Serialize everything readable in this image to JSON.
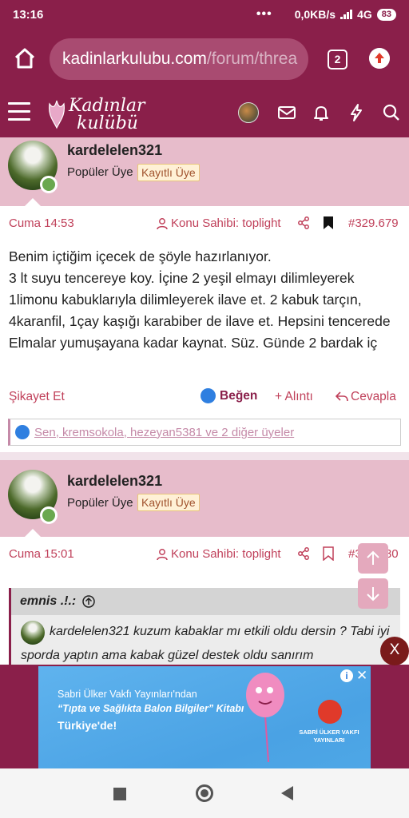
{
  "status_bar": {
    "time": "13:16",
    "dots": "•••",
    "network_speed": "0,0KB/s",
    "network_type": "4G",
    "battery": "83"
  },
  "browser": {
    "url_main": "kadinlarkulubu.com",
    "url_path": "/forum/threa",
    "tab_count": "2"
  },
  "site": {
    "logo_line1": "Kadınlar",
    "logo_line2": "kulübü"
  },
  "posts": [
    {
      "username": "kardelelen321",
      "role": "Popüler Üye",
      "badge": "Kayıtlı Üye",
      "time": "Cuma 14:53",
      "owner_label": "Konu Sahibi: toplight",
      "post_number": "#329.679",
      "body": "Benim içtiğim içecek de şöyle hazırlanıyor.\n3 lt suyu tencereye koy. İçine 2 yeşil elmayı dilimleyerek 1limonu kabuklarıyla dilimleyerek ilave et. 2 kabuk tarçın, 4karanfil, 1çay kaşığı karabiber de ilave et. Hepsini tencerede Elmalar yumuşayana kadar kaynat. Süz. Günde 2 bardak iç",
      "actions": {
        "report": "Şikayet Et",
        "like": "Beğen",
        "quote": "+ Alıntı",
        "reply": "Cevapla"
      },
      "likes_text": "Sen, kremsokola, hezeyan5381 ve 2 diğer üyeler"
    },
    {
      "username": "kardelelen321",
      "role": "Popüler Üye",
      "badge": "Kayıtlı Üye",
      "time": "Cuma 15:01",
      "owner_label": "Konu Sahibi: toplight",
      "post_number": "#329.680",
      "quote": {
        "author": "emnis .!.:",
        "text": "kardelelen321 kuzum kabaklar mı etkili oldu dersin ? Tabi iyi sporda yaptın ama kabak güzel destek oldu sanırım"
      }
    }
  ],
  "ad": {
    "line1": "Sabri Ülker Vakfı Yayınları'ndan",
    "line2": "“Tıpta ve Sağlıkta Balon Bilgiler” Kitabı",
    "line3": "Türkiye'de!",
    "foundation": "SABRİ ÜLKER VAKFI YAYINLARI",
    "info": "i",
    "close": "✕"
  },
  "close_ad_label": "X",
  "colors": {
    "brand": "#8a1f4a",
    "post_header_bg": "#e7bccb",
    "accent_text": "#c0405a",
    "like_blue": "#2f7fe0"
  },
  "icons": [
    "home-icon",
    "update-icon",
    "menu-icon",
    "mail-icon",
    "bell-icon",
    "lightning-icon",
    "search-icon",
    "user-icon",
    "share-icon",
    "bookmark-icon",
    "like-icon",
    "reply-icon",
    "arrow-up-icon",
    "arrow-down-icon"
  ]
}
